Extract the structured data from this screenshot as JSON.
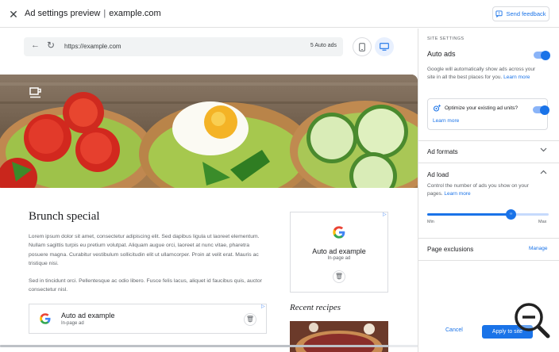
{
  "header": {
    "title": "Ad settings preview",
    "separator": "|",
    "domain": "example.com",
    "feedback_label": "Send feedback"
  },
  "browser": {
    "url": "https://example.com",
    "ad_count": "5 Auto ads"
  },
  "article": {
    "title": "Brunch special",
    "para1": "Lorem ipsum dolor sit amet, consectetur adipiscing elit. Sed dapibus ligula ut laoreet elementum. Nullam sagittis turpis eu pretium volutpat. Aliquam augue orci, laoreet at nunc vitae, pharetra posuere magna. Curabitur vestibulum sollicitudin elit ut ullamcorper. Proin at velit erat. Mauris ac tristique nisi.",
    "para2": "Sed in tincidunt orci. Pellentesque ac odio libero. Fusce felis lacus, aliquet id faucibus quis, auctor consectetur nisl.",
    "recent_title": "Recent recipes"
  },
  "inline_ad": {
    "title": "Auto ad example",
    "subtitle": "In-page ad"
  },
  "side_ad": {
    "title": "Auto ad example",
    "subtitle": "In-page ad"
  },
  "panel": {
    "section_label": "SITE SETTINGS",
    "auto_ads": {
      "title": "Auto ads",
      "enabled": true,
      "description": "Google will automatically show ads across your site in all the best places for you.",
      "learn_more": "Learn more"
    },
    "optimize": {
      "label": "Optimize your existing ad units?",
      "enabled": true,
      "learn_more": "Learn more"
    },
    "ad_formats": {
      "title": "Ad formats"
    },
    "ad_load": {
      "title": "Ad load",
      "description": "Control the number of ads you show on your pages.",
      "learn_more": "Learn more",
      "min_label": "Min",
      "max_label": "Max",
      "value": 0.69
    },
    "page_exclusions": {
      "title": "Page exclusions",
      "manage_label": "Manage"
    },
    "cancel_label": "Cancel",
    "apply_label": "Apply to site"
  },
  "colors": {
    "accent": "#1a73e8",
    "accent_light": "#8ab4f8"
  }
}
